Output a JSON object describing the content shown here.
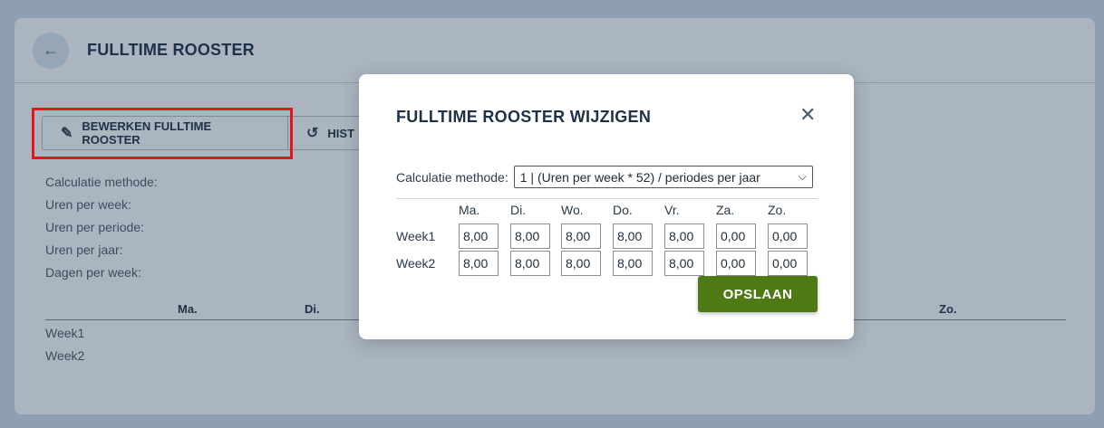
{
  "page": {
    "title": "FULLTIME ROOSTER",
    "buttons": {
      "edit": "BEWERKEN FULLTIME ROOSTER",
      "history": "HIST"
    },
    "info_labels": [
      "Calculatie methode:",
      "Uren per week:",
      "Uren per periode:",
      "Uren per jaar:",
      "Dagen per week:"
    ],
    "table_headers": {
      "ma": "Ma.",
      "di": "Di.",
      "zo": "Zo."
    },
    "weeks": [
      "Week1",
      "Week2"
    ]
  },
  "modal": {
    "title": "FULLTIME ROOSTER WIJZIGEN",
    "calc_label": "Calculatie methode:",
    "calc_value": "1 | (Uren per week * 52) / periodes per jaar",
    "days": [
      "Ma.",
      "Di.",
      "Wo.",
      "Do.",
      "Vr.",
      "Za.",
      "Zo."
    ],
    "rows": [
      {
        "label": "Week1",
        "values": [
          "8,00",
          "8,00",
          "8,00",
          "8,00",
          "8,00",
          "0,00",
          "0,00"
        ]
      },
      {
        "label": "Week2",
        "values": [
          "8,00",
          "8,00",
          "8,00",
          "8,00",
          "8,00",
          "0,00",
          "0,00"
        ]
      }
    ],
    "save_label": "OPSLAAN"
  },
  "colors": {
    "accent_save": "#4d7a14",
    "highlight": "#e8141b",
    "title": "#1f3147"
  }
}
